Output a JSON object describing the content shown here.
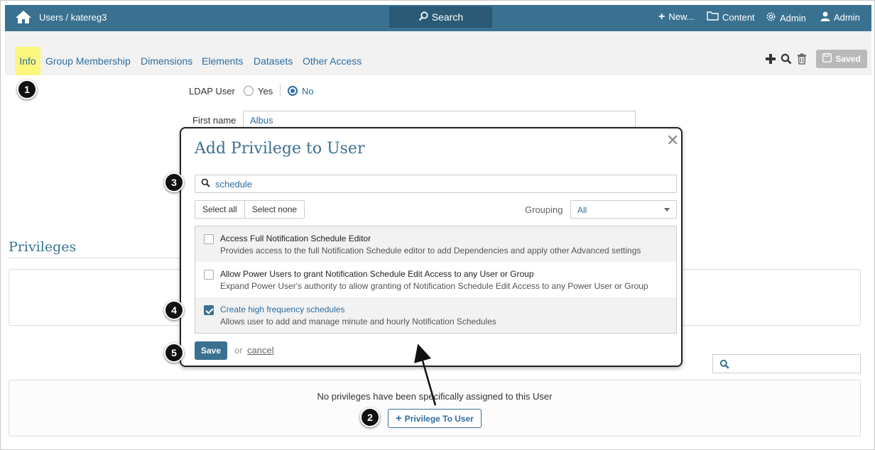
{
  "navbar": {
    "breadcrumb": "Users / katereg3",
    "search_label": "Search",
    "new_label": "New...",
    "content_label": "Content",
    "admin_menu_label": "Admin",
    "user_label": "Admin"
  },
  "tabs": {
    "active": "Info",
    "items": [
      "Group Membership",
      "Dimensions",
      "Elements",
      "Datasets",
      "Other Access"
    ]
  },
  "toolbar": {
    "saved_label": "Saved"
  },
  "form": {
    "ldap_label": "LDAP User",
    "ldap_yes": "Yes",
    "ldap_no": "No",
    "ldap_value": "No",
    "first_name_label": "First name",
    "first_name_value": "Albus"
  },
  "privileges": {
    "heading": "Privileges",
    "empty_text": "No privileges have been specifically assigned to this User",
    "add_button": "Privilege To User"
  },
  "modal": {
    "title": "Add Privilege to User",
    "search_value": "schedule",
    "select_all": "Select all",
    "select_none": "Select none",
    "grouping_label": "Grouping",
    "grouping_value": "All",
    "items": [
      {
        "title": "Access Full Notification Schedule Editor",
        "desc": "Provides access to the full Notification Schedule editor to add Dependencies and apply other Advanced settings",
        "checked": false
      },
      {
        "title": "Allow Power Users to grant Notification Schedule Edit Access to any User or Group",
        "desc": "Expand Power User's authority to allow granting of Notification Schedule Edit Access to any Power User or Group",
        "checked": false
      },
      {
        "title": "Create high frequency schedules",
        "desc": "Allows user to add and manage minute and hourly Notification Schedules",
        "checked": true
      }
    ],
    "save_label": "Save",
    "or_text": "or",
    "cancel_label": "cancel"
  },
  "callouts": [
    "1",
    "2",
    "3",
    "4",
    "5"
  ],
  "colors": {
    "navbar": "#3a7190",
    "link": "#2e6da0",
    "highlight": "#fcf77e",
    "save_button": "#3a7190"
  }
}
